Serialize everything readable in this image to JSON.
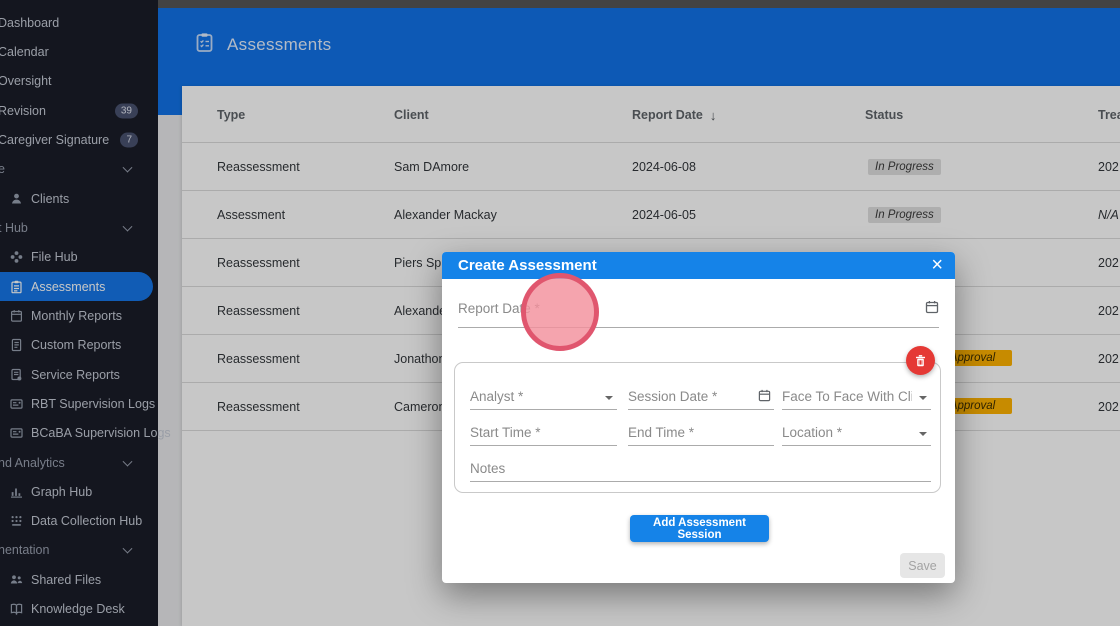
{
  "header": {
    "title": "Assessments",
    "icon": "assessments-clipboard-icon"
  },
  "sidebar": {
    "items": [
      {
        "label": "Dashboard",
        "type": "plain"
      },
      {
        "label": "Calendar",
        "type": "plain"
      },
      {
        "label": "Oversight",
        "type": "plain"
      },
      {
        "label": "Revision",
        "type": "plain",
        "badge": "39"
      },
      {
        "label": "Caregiver Signature",
        "type": "plain",
        "badge": "7"
      },
      {
        "label": "e",
        "type": "group"
      },
      {
        "label": "Clients",
        "type": "item",
        "icon": "person-icon"
      },
      {
        "label": "t Hub",
        "type": "group"
      },
      {
        "label": "File Hub",
        "type": "item",
        "icon": "file-hub-icon"
      },
      {
        "label": "Assessments",
        "type": "item",
        "icon": "assessments-icon",
        "active": true
      },
      {
        "label": "Monthly Reports",
        "type": "item",
        "icon": "monthly-reports-icon"
      },
      {
        "label": "Custom Reports",
        "type": "item",
        "icon": "custom-reports-icon"
      },
      {
        "label": "Service Reports",
        "type": "item",
        "icon": "service-reports-icon"
      },
      {
        "label": "RBT Supervision Logs",
        "type": "item",
        "icon": "rbt-supervision-logs-icon"
      },
      {
        "label": "BCaBA Supervision Logs",
        "type": "item",
        "icon": "bcaba-supervision-logs-icon"
      },
      {
        "label": "nd Analytics",
        "type": "group"
      },
      {
        "label": "Graph Hub",
        "type": "item",
        "icon": "graph-hub-icon"
      },
      {
        "label": "Data Collection Hub",
        "type": "item",
        "icon": "data-collection-hub-icon"
      },
      {
        "label": "nentation",
        "type": "group"
      },
      {
        "label": "Shared Files",
        "type": "item",
        "icon": "shared-files-icon"
      },
      {
        "label": "Knowledge Desk",
        "type": "item",
        "icon": "knowledge-desk-icon"
      }
    ]
  },
  "table": {
    "columns": [
      "Type",
      "Client",
      "Report Date",
      "Status",
      "Treat"
    ],
    "sorted_by": "Report Date",
    "sort_direction": "desc",
    "rows": [
      {
        "type": "Reassessment",
        "client": "Sam DAmore",
        "report_date": "2024-06-08",
        "status": "In Progress",
        "status_kind": "gray",
        "treatment": "202"
      },
      {
        "type": "Assessment",
        "client": "Alexander Mackay",
        "report_date": "2024-06-05",
        "status": "In Progress",
        "status_kind": "gray",
        "treatment": "N/A"
      },
      {
        "type": "Reassessment",
        "client": "Piers Sprin",
        "report_date": "",
        "status": "",
        "status_kind": "none",
        "treatment": "202"
      },
      {
        "type": "Reassessment",
        "client": "Alexander M",
        "report_date": "",
        "status": "",
        "status_kind": "none",
        "treatment": "202"
      },
      {
        "type": "Reassessment",
        "client": "Jonathon W",
        "report_date": "",
        "status": "Pending Approval",
        "status_kind": "orange",
        "treatment": "202"
      },
      {
        "type": "Reassessment",
        "client": "Cameron T",
        "report_date": "",
        "status": "Pending Approval",
        "status_kind": "orange",
        "treatment": "202"
      }
    ]
  },
  "modal": {
    "title": "Create Assessment",
    "close_label": "×",
    "report_date_label": "Report Date *",
    "session": {
      "analyst_label": "Analyst *",
      "session_date_label": "Session Date *",
      "face_to_face_label": "Face To Face With Clien…",
      "start_time_label": "Start Time *",
      "end_time_label": "End Time *",
      "location_label": "Location *",
      "notes_label": "Notes"
    },
    "buttons": {
      "add_session": "Add Assessment Session",
      "save": "Save"
    }
  },
  "annotation": {
    "type": "highlight-circle",
    "color": "#e0566e"
  },
  "colors": {
    "accent_blue": "#1583e8",
    "header_blue": "#1173e8",
    "sidebar_bg": "#1a1d28",
    "active_item_blue": "#1777e8",
    "status_gray_chip": "#dfdfdf",
    "status_orange_chip": "#ffb300",
    "delete_red": "#e53935"
  }
}
